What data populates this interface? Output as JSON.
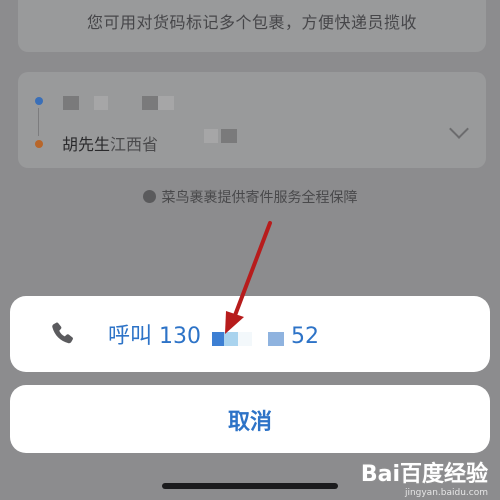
{
  "background": {
    "tip_text": "您可用对货码标记多个包裹，方便快递员揽收"
  },
  "address_card": {
    "receiver_name": "胡先生",
    "receiver_province": "江西省"
  },
  "assurance_text": "菜鸟裹裹提供寄件服务全程保障",
  "action_sheet": {
    "call_label_prefix": "呼叫 130",
    "call_label_suffix": "52",
    "cancel_label": "取消",
    "phone_icon": "phone-icon",
    "accent_color": "#2d73c7"
  },
  "watermark": {
    "brand": "Bai百度经验",
    "site": "jingyan.baidu.com"
  }
}
